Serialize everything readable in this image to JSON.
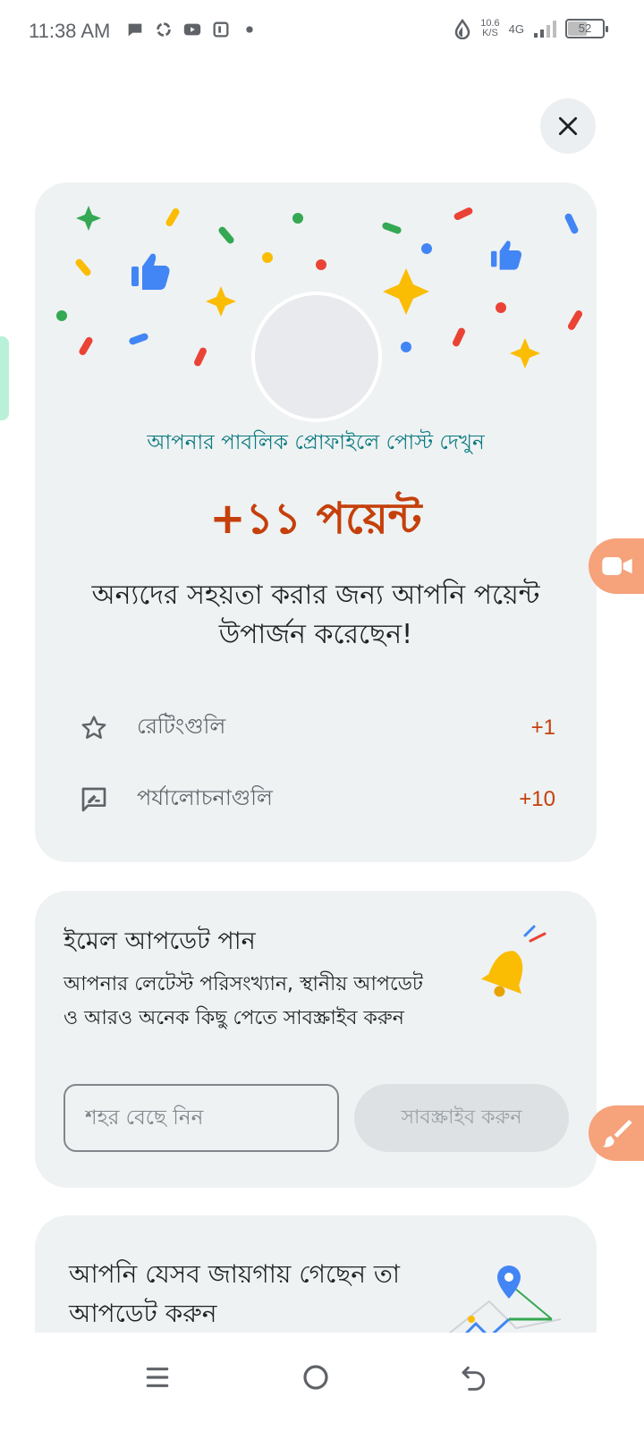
{
  "status_bar": {
    "time": "11:38 AM",
    "net_speed": "10.6",
    "net_unit": "K/S",
    "network": "4G",
    "battery": "52"
  },
  "close_icon": "close-icon",
  "points_card": {
    "profile_link": "আপনার পাবলিক প্রোফাইলে পোস্ট দেখুন",
    "points": "+১১ পয়েন্ট",
    "message": "অন্যদের সহয়তা করার জন্য আপনি পয়েন্ট উপার্জন করেছেন!",
    "rows": [
      {
        "icon": "star-outline-icon",
        "label": "রেটিংগুলি",
        "value": "+1"
      },
      {
        "icon": "review-icon",
        "label": "পর্যালোচনাগুলি",
        "value": "+10"
      }
    ],
    "colors": {
      "accent": "#c5400b",
      "link": "#0b7a80"
    }
  },
  "email_card": {
    "title": "ইমেল আপডেট পান",
    "description": "আপনার লেটেস্ট পরিসংখ্যান, স্থানীয় আপডেট ও আরও অনেক কিছু পেতে সাবস্ক্রাইব করুন",
    "city_placeholder": "শহর বেছে নিন",
    "subscribe_label": "সাবস্ক্রাইব করুন"
  },
  "places_card": {
    "title": "আপনি যেসব জায়গায় গেছেন তা আপডেট করুন"
  },
  "nav": {
    "recents_icon": "recents-icon",
    "home_icon": "home-icon",
    "back_icon": "back-icon"
  }
}
